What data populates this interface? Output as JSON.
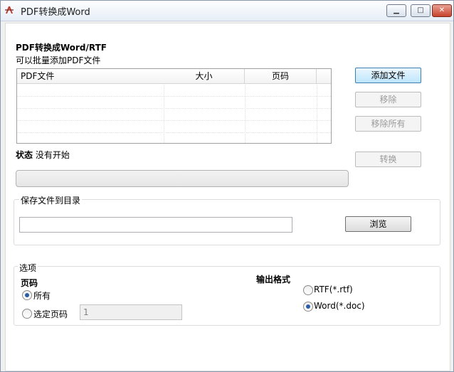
{
  "window": {
    "title": "PDF转换成Word"
  },
  "header": {
    "title": "PDF转换成Word/RTF",
    "subtitle": "可以批量添加PDF文件"
  },
  "file_table": {
    "columns": [
      "PDF文件",
      "大小",
      "页码"
    ],
    "rows": []
  },
  "buttons": {
    "add": "添加文件",
    "remove": "移除",
    "remove_all": "移除所有",
    "convert": "转换",
    "browse": "浏览"
  },
  "status": {
    "label": "状态",
    "value": "没有开始"
  },
  "save": {
    "group_label": "保存文件到目录",
    "path": ""
  },
  "options": {
    "group_label": "选项",
    "pages_label": "页码",
    "all_label": "所有",
    "selected_label": "选定页码",
    "page_value": "1",
    "pages_choice": "所有",
    "format_label": "输出格式",
    "rtf_label": "RTF(*.rtf)",
    "doc_label": "Word(*.doc)",
    "format_choice": "Word(*.doc)"
  }
}
